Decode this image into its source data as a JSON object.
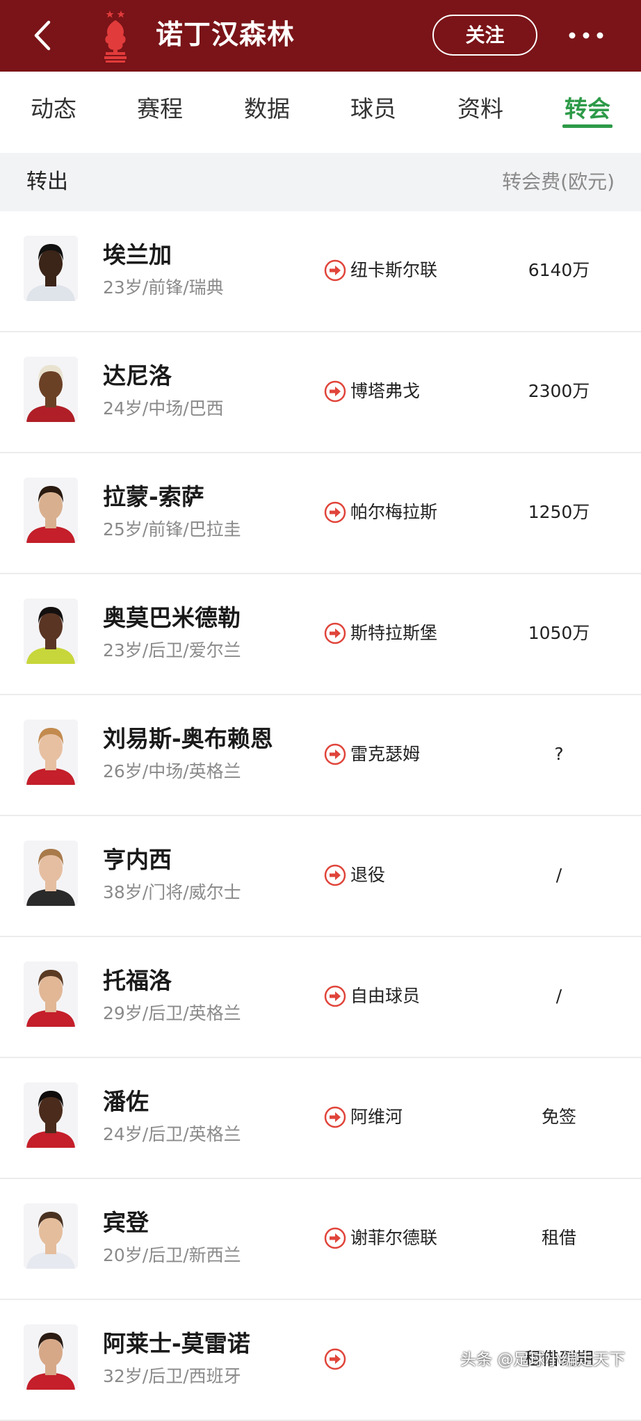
{
  "header": {
    "club_name": "诺丁汉森林",
    "follow_label": "关注",
    "back_icon": "chevron-left-icon",
    "more_icon": "more-dots-icon",
    "logo": "nottingham-forest-crest",
    "background_color": "#7a1418"
  },
  "tabs": [
    {
      "label": "动态"
    },
    {
      "label": "赛程"
    },
    {
      "label": "数据"
    },
    {
      "label": "球员"
    },
    {
      "label": "资料"
    },
    {
      "label": "转会",
      "active": true
    }
  ],
  "accent_color": "#2d9a48",
  "section": {
    "title": "转出",
    "fee_header": "转会费(欧元)"
  },
  "transfers": [
    {
      "name": "埃兰加",
      "info": "23岁/前锋/瑞典",
      "destination": "纽卡斯尔联",
      "fee": "6140万",
      "skin": "#3b2418",
      "hair": "#111111",
      "shirt": "#dfe3ea"
    },
    {
      "name": "达尼洛",
      "info": "24岁/中场/巴西",
      "destination": "博塔弗戈",
      "fee": "2300万",
      "skin": "#6b4126",
      "hair": "#e8e2cf",
      "shirt": "#b01f27"
    },
    {
      "name": "拉蒙-索萨",
      "info": "25岁/前锋/巴拉圭",
      "destination": "帕尔梅拉斯",
      "fee": "1250万",
      "skin": "#d9b08f",
      "hair": "#2a1a10",
      "shirt": "#c41f2a"
    },
    {
      "name": "奥莫巴米德勒",
      "info": "23岁/后卫/爱尔兰",
      "destination": "斯特拉斯堡",
      "fee": "1050万",
      "skin": "#5a3524",
      "hair": "#141010",
      "shirt": "#c7d63a"
    },
    {
      "name": "刘易斯-奥布赖恩",
      "info": "26岁/中场/英格兰",
      "destination": "雷克瑟姆",
      "fee": "?",
      "skin": "#e7c0a2",
      "hair": "#c38a4e",
      "shirt": "#c41f2a"
    },
    {
      "name": "亨内西",
      "info": "38岁/门将/威尔士",
      "destination": "退役",
      "fee": "/",
      "skin": "#e5bea1",
      "hair": "#a87a4a",
      "shirt": "#2a2a2a"
    },
    {
      "name": "托福洛",
      "info": "29岁/后卫/英格兰",
      "destination": "自由球员",
      "fee": "/",
      "skin": "#e1b796",
      "hair": "#5a3a22",
      "shirt": "#c41f2a"
    },
    {
      "name": "潘佐",
      "info": "24岁/后卫/英格兰",
      "destination": "阿维河",
      "fee": "免签",
      "skin": "#4a2b1c",
      "hair": "#0f0c0b",
      "shirt": "#c41f2a"
    },
    {
      "name": "宾登",
      "info": "20岁/后卫/新西兰",
      "destination": "谢菲尔德联",
      "fee": "租借",
      "skin": "#e4bd9c",
      "hair": "#4a3222",
      "shirt": "#e6e9ef"
    },
    {
      "name": "阿莱士-莫雷诺",
      "info": "32岁/后卫/西班牙",
      "destination": "",
      "fee": "租借到期",
      "skin": "#d6a888",
      "hair": "#2a1c14",
      "shirt": "#c41f2a"
    }
  ],
  "watermark": "头条 @足球小编走天下"
}
